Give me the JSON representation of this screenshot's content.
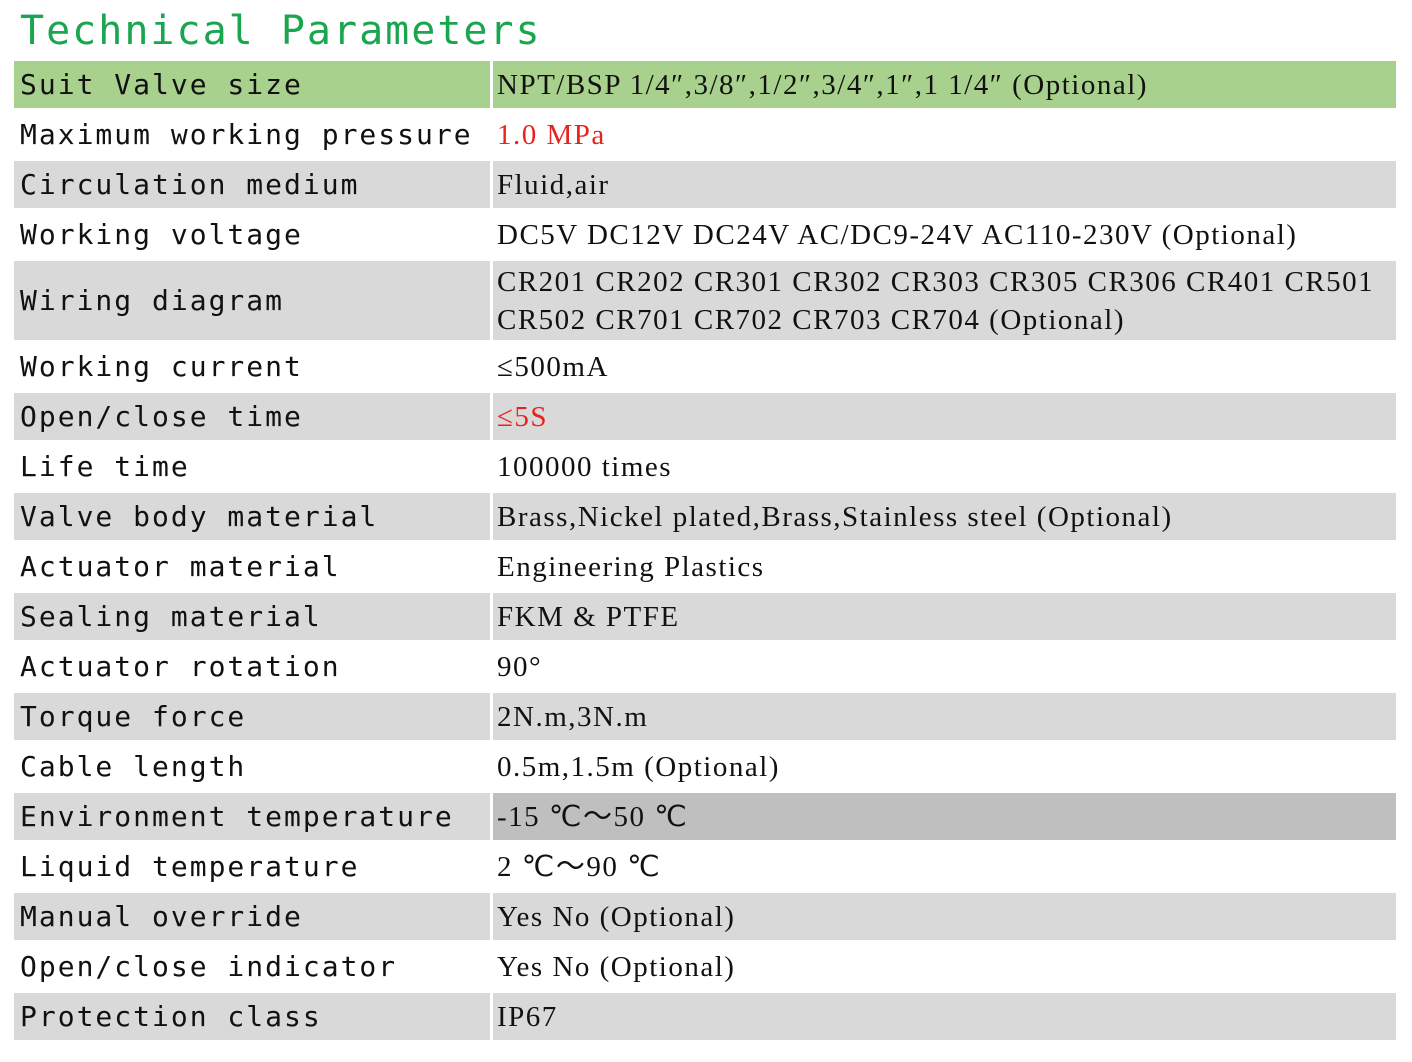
{
  "title": "Technical Parameters",
  "rows": [
    {
      "label": "Suit Valve size",
      "value": "NPT/BSP 1/4″,3/8″,1/2″,3/4″,1″,1 1/4″ (Optional)"
    },
    {
      "label": "Maximum working pressure",
      "value": "1.0 MPa"
    },
    {
      "label": "Circulation medium",
      "value": "Fluid,air"
    },
    {
      "label": "Working voltage",
      "value": "DC5V DC12V DC24V AC/DC9-24V AC110-230V (Optional)"
    },
    {
      "label": "Wiring diagram",
      "value": "CR201 CR202 CR301 CR302 CR303 CR305 CR306 CR401 CR501 CR502 CR701 CR702 CR703 CR704 (Optional)"
    },
    {
      "label": "Working current",
      "value": "≤500mA"
    },
    {
      "label": "Open/close time",
      "value": "≤5S"
    },
    {
      "label": "Life time",
      "value": "100000 times"
    },
    {
      "label": "Valve body material",
      "value": "Brass,Nickel plated,Brass,Stainless steel (Optional)"
    },
    {
      "label": "Actuator material",
      "value": "Engineering Plastics"
    },
    {
      "label": "Sealing material",
      "value": "FKM & PTFE"
    },
    {
      "label": "Actuator rotation",
      "value": "90°"
    },
    {
      "label": "Torque force",
      "value": "2N.m,3N.m"
    },
    {
      "label": "Cable length",
      "value": "0.5m,1.5m (Optional)"
    },
    {
      "label": "Environment temperature",
      "value": "-15 ℃～50 ℃"
    },
    {
      "label": "Liquid temperature",
      "value": "2 ℃～90 ℃"
    },
    {
      "label": "Manual override",
      "value": "Yes No (Optional)"
    },
    {
      "label": "Open/close indicator",
      "value": "Yes No (Optional)"
    },
    {
      "label": "Protection class",
      "value": "IP67"
    }
  ],
  "colors": {
    "title": "#1aa64f",
    "header_row": "#a9d18e",
    "shaded_row": "#d9d9d9",
    "dark_cell": "#bfbfbf",
    "highlight_text": "#e8231f"
  }
}
